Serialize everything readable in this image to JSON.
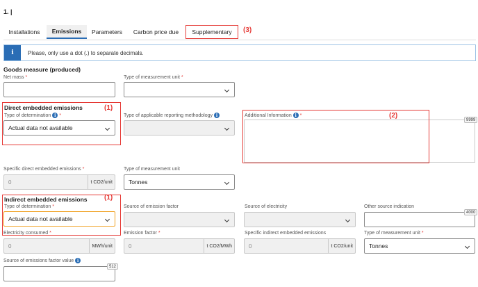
{
  "page": {
    "title": "1. |"
  },
  "tabs": [
    {
      "label": "Installations"
    },
    {
      "label": "Emissions"
    },
    {
      "label": "Parameters"
    },
    {
      "label": "Carbon price due"
    },
    {
      "label": "Supplementary"
    }
  ],
  "annotations": {
    "a3": "(3)",
    "a1": "(1)",
    "a2": "(2)"
  },
  "info": {
    "icon": "i",
    "text": "Please, only use a dot (.) to separate decimals."
  },
  "goods": {
    "heading": "Goods measure (produced)",
    "net_mass_label": "Net mass",
    "unit_label": "Type of measurement unit",
    "net_mass_value": "",
    "unit_value": ""
  },
  "direct": {
    "heading": "Direct embedded emissions",
    "determination_label": "Type of determination",
    "determination_value": "Actual data not available",
    "methodology_label": "Type of applicable reporting methodology",
    "methodology_value": "",
    "additional_label": "Additional Information",
    "additional_counter": "9999",
    "specific_label": "Specific direct embedded emissions",
    "specific_value": "0",
    "specific_unit": "t CO2/unit",
    "unit_label": "Type of measurement unit",
    "unit_value": "Tonnes"
  },
  "indirect": {
    "heading": "Indirect embedded emissions",
    "determination_label": "Type of determination",
    "determination_value": "Actual data not available",
    "source_factor_label": "Source of emission factor",
    "source_electricity_label": "Source of electricity",
    "other_source_label": "Other source indication",
    "other_source_counter": "4000",
    "electricity_label": "Electricity consumed",
    "electricity_value": "0",
    "electricity_unit": "MWh/unit",
    "emission_factor_label": "Emission factor",
    "emission_factor_value": "0",
    "emission_factor_unit": "t CO2/MWh",
    "specific_label": "Specific indirect embedded emissions",
    "specific_value": "0",
    "specific_unit": "t CO2/unit",
    "unit_label": "Type of measurement unit",
    "unit_value": "Tonnes",
    "factor_value_label": "Source of emissions factor value",
    "factor_value_counter": "512"
  },
  "required_mark": "*",
  "badge_glyph": "i",
  "colors": {
    "accent": "#2a6db5",
    "annotation": "#e53935",
    "highlight": "#f0a020"
  }
}
